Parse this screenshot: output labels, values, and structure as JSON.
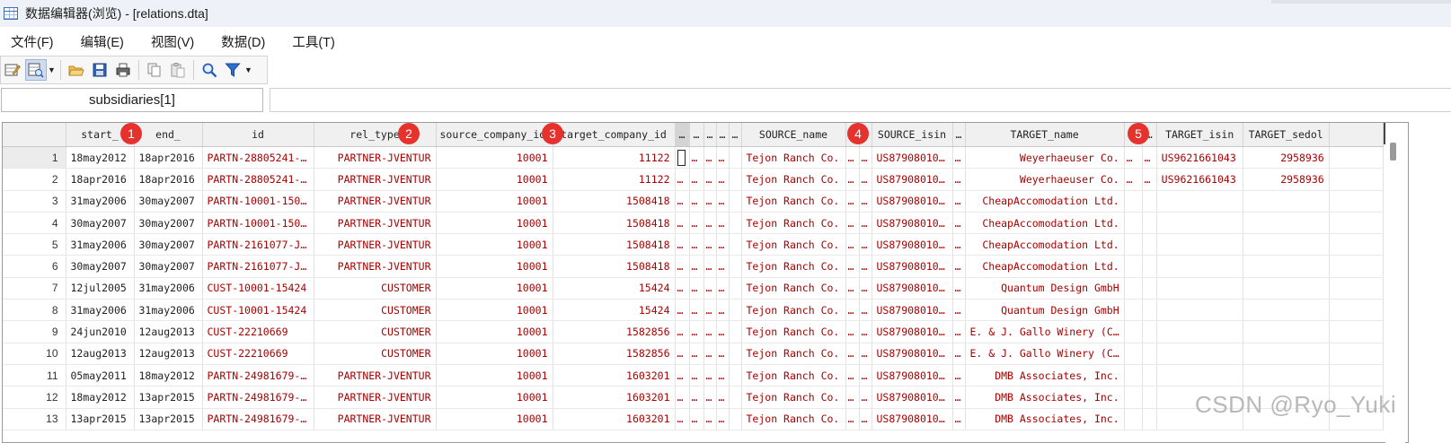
{
  "window": {
    "title": "数据编辑器(浏览) - [relations.dta]"
  },
  "menu": [
    "文件(F)",
    "编辑(E)",
    "视图(V)",
    "数据(D)",
    "工具(T)"
  ],
  "toolbar": {
    "icons": [
      "edit-mode-icon",
      "browse-mode-icon",
      "open-folder-icon",
      "save-icon",
      "print-icon",
      "copy-icon",
      "paste-icon",
      "find-icon",
      "filter-icon"
    ]
  },
  "varname": "subsidiaries[1]",
  "badges": [
    "1",
    "2",
    "3",
    "4",
    "5"
  ],
  "columns": [
    "start_",
    "end_",
    "id",
    "rel_type",
    "source_company_id",
    "target_company_id",
    "…",
    "…",
    "…",
    "…",
    "…",
    "SOURCE_name",
    "…",
    "…",
    "SOURCE_isin",
    "…",
    "TARGET_name",
    "…",
    "…",
    "TARGET_isin",
    "TARGET_sedol"
  ],
  "rows": [
    {
      "n": "1",
      "start": "18may2012",
      "end": "18apr2016",
      "id": "PARTN-28805241-…",
      "rel": "PARTNER-JVENTUR",
      "src": "10001",
      "tgt": "11122",
      "e1": "",
      "e2": "…",
      "e3": "…",
      "e4": "…",
      "sname": "Tejon Ranch Co.",
      "e5": "…",
      "e6": "…",
      "sisin": "US87908010…",
      "e7": "…",
      "tname": "Weyerhaeuser Co.",
      "e8": "…",
      "e9": "…",
      "tisin": "US9621661043",
      "tsedol": "2958936"
    },
    {
      "n": "2",
      "start": "18apr2016",
      "end": "18apr2016",
      "id": "PARTN-28805241-…",
      "rel": "PARTNER-JVENTUR",
      "src": "10001",
      "tgt": "11122",
      "e1": "…",
      "e2": "…",
      "e3": "…",
      "e4": "…",
      "sname": "Tejon Ranch Co.",
      "e5": "…",
      "e6": "…",
      "sisin": "US87908010…",
      "e7": "…",
      "tname": "Weyerhaeuser Co.",
      "e8": "…",
      "e9": "…",
      "tisin": "US9621661043",
      "tsedol": "2958936"
    },
    {
      "n": "3",
      "start": "31may2006",
      "end": "30may2007",
      "id": "PARTN-10001-150…",
      "rel": "PARTNER-JVENTUR",
      "src": "10001",
      "tgt": "1508418",
      "e1": "…",
      "e2": "…",
      "e3": "…",
      "e4": "…",
      "sname": "Tejon Ranch Co.",
      "e5": "…",
      "e6": "…",
      "sisin": "US87908010…",
      "e7": "…",
      "tname": "CheapAccomodation Ltd.",
      "e8": "",
      "e9": "",
      "tisin": "",
      "tsedol": ""
    },
    {
      "n": "4",
      "start": "30may2007",
      "end": "30may2007",
      "id": "PARTN-10001-150…",
      "rel": "PARTNER-JVENTUR",
      "src": "10001",
      "tgt": "1508418",
      "e1": "…",
      "e2": "…",
      "e3": "…",
      "e4": "…",
      "sname": "Tejon Ranch Co.",
      "e5": "…",
      "e6": "…",
      "sisin": "US87908010…",
      "e7": "…",
      "tname": "CheapAccomodation Ltd.",
      "e8": "",
      "e9": "",
      "tisin": "",
      "tsedol": ""
    },
    {
      "n": "5",
      "start": "31may2006",
      "end": "30may2007",
      "id": "PARTN-2161077-J…",
      "rel": "PARTNER-JVENTUR",
      "src": "10001",
      "tgt": "1508418",
      "e1": "…",
      "e2": "…",
      "e3": "…",
      "e4": "…",
      "sname": "Tejon Ranch Co.",
      "e5": "…",
      "e6": "…",
      "sisin": "US87908010…",
      "e7": "…",
      "tname": "CheapAccomodation Ltd.",
      "e8": "",
      "e9": "",
      "tisin": "",
      "tsedol": ""
    },
    {
      "n": "6",
      "start": "30may2007",
      "end": "30may2007",
      "id": "PARTN-2161077-J…",
      "rel": "PARTNER-JVENTUR",
      "src": "10001",
      "tgt": "1508418",
      "e1": "…",
      "e2": "…",
      "e3": "…",
      "e4": "…",
      "sname": "Tejon Ranch Co.",
      "e5": "…",
      "e6": "…",
      "sisin": "US87908010…",
      "e7": "…",
      "tname": "CheapAccomodation Ltd.",
      "e8": "",
      "e9": "",
      "tisin": "",
      "tsedol": ""
    },
    {
      "n": "7",
      "start": "12jul2005",
      "end": "31may2006",
      "id": "CUST-10001-15424",
      "rel": "CUSTOMER",
      "src": "10001",
      "tgt": "15424",
      "e1": "…",
      "e2": "…",
      "e3": "…",
      "e4": "…",
      "sname": "Tejon Ranch Co.",
      "e5": "…",
      "e6": "…",
      "sisin": "US87908010…",
      "e7": "…",
      "tname": "Quantum Design GmbH",
      "e8": "",
      "e9": "",
      "tisin": "",
      "tsedol": ""
    },
    {
      "n": "8",
      "start": "31may2006",
      "end": "31may2006",
      "id": "CUST-10001-15424",
      "rel": "CUSTOMER",
      "src": "10001",
      "tgt": "15424",
      "e1": "…",
      "e2": "…",
      "e3": "…",
      "e4": "…",
      "sname": "Tejon Ranch Co.",
      "e5": "…",
      "e6": "…",
      "sisin": "US87908010…",
      "e7": "…",
      "tname": "Quantum Design GmbH",
      "e8": "",
      "e9": "",
      "tisin": "",
      "tsedol": ""
    },
    {
      "n": "9",
      "start": "24jun2010",
      "end": "12aug2013",
      "id": "CUST-22210669",
      "rel": "CUSTOMER",
      "src": "10001",
      "tgt": "1582856",
      "e1": "…",
      "e2": "…",
      "e3": "…",
      "e4": "…",
      "sname": "Tejon Ranch Co.",
      "e5": "…",
      "e6": "…",
      "sisin": "US87908010…",
      "e7": "…",
      "tname": "E. & J. Gallo Winery (C…",
      "e8": "",
      "e9": "",
      "tisin": "",
      "tsedol": ""
    },
    {
      "n": "10",
      "start": "12aug2013",
      "end": "12aug2013",
      "id": "CUST-22210669",
      "rel": "CUSTOMER",
      "src": "10001",
      "tgt": "1582856",
      "e1": "…",
      "e2": "…",
      "e3": "…",
      "e4": "…",
      "sname": "Tejon Ranch Co.",
      "e5": "…",
      "e6": "…",
      "sisin": "US87908010…",
      "e7": "…",
      "tname": "E. & J. Gallo Winery (C…",
      "e8": "",
      "e9": "",
      "tisin": "",
      "tsedol": ""
    },
    {
      "n": "11",
      "start": "05may2011",
      "end": "18may2012",
      "id": "PARTN-24981679-…",
      "rel": "PARTNER-JVENTUR",
      "src": "10001",
      "tgt": "1603201",
      "e1": "…",
      "e2": "…",
      "e3": "…",
      "e4": "…",
      "sname": "Tejon Ranch Co.",
      "e5": "…",
      "e6": "…",
      "sisin": "US87908010…",
      "e7": "…",
      "tname": "DMB Associates, Inc.",
      "e8": "",
      "e9": "",
      "tisin": "",
      "tsedol": ""
    },
    {
      "n": "12",
      "start": "18may2012",
      "end": "13apr2015",
      "id": "PARTN-24981679-…",
      "rel": "PARTNER-JVENTUR",
      "src": "10001",
      "tgt": "1603201",
      "e1": "…",
      "e2": "…",
      "e3": "…",
      "e4": "…",
      "sname": "Tejon Ranch Co.",
      "e5": "…",
      "e6": "…",
      "sisin": "US87908010…",
      "e7": "…",
      "tname": "DMB Associates, Inc.",
      "e8": "",
      "e9": "",
      "tisin": "",
      "tsedol": ""
    },
    {
      "n": "13",
      "start": "13apr2015",
      "end": "13apr2015",
      "id": "PARTN-24981679-…",
      "rel": "PARTNER-JVENTUR",
      "src": "10001",
      "tgt": "1603201",
      "e1": "…",
      "e2": "…",
      "e3": "…",
      "e4": "…",
      "sname": "Tejon Ranch Co.",
      "e5": "…",
      "e6": "…",
      "sisin": "US87908010…",
      "e7": "…",
      "tname": "DMB Associates, Inc.",
      "e8": "",
      "e9": "",
      "tisin": "",
      "tsedol": ""
    }
  ],
  "watermark": "CSDN @Ryo_Yuki",
  "colors": {
    "value_text": "#a80000",
    "badge": "#e5322d",
    "selected_header": "#d4d4d4"
  }
}
